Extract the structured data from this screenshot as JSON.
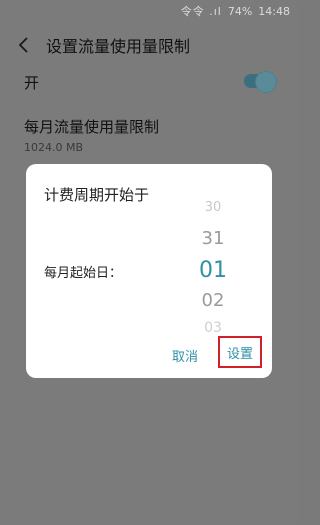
{
  "status": {
    "signal": "令令 .ıl",
    "battery": "74%",
    "time": "14:48"
  },
  "header": {
    "title": "设置流量使用量限制"
  },
  "settings": {
    "toggle_label": "开",
    "monthly_limit_label": "每月流量使用量限制",
    "monthly_limit_value": "1024.0 MB"
  },
  "dialog": {
    "title": "计费周期开始于",
    "day_label": "每月起始日：",
    "picker_options": [
      "30",
      "31",
      "01",
      "02",
      "03"
    ],
    "selected": "01",
    "cancel_label": "取消",
    "ok_label": "设置"
  }
}
